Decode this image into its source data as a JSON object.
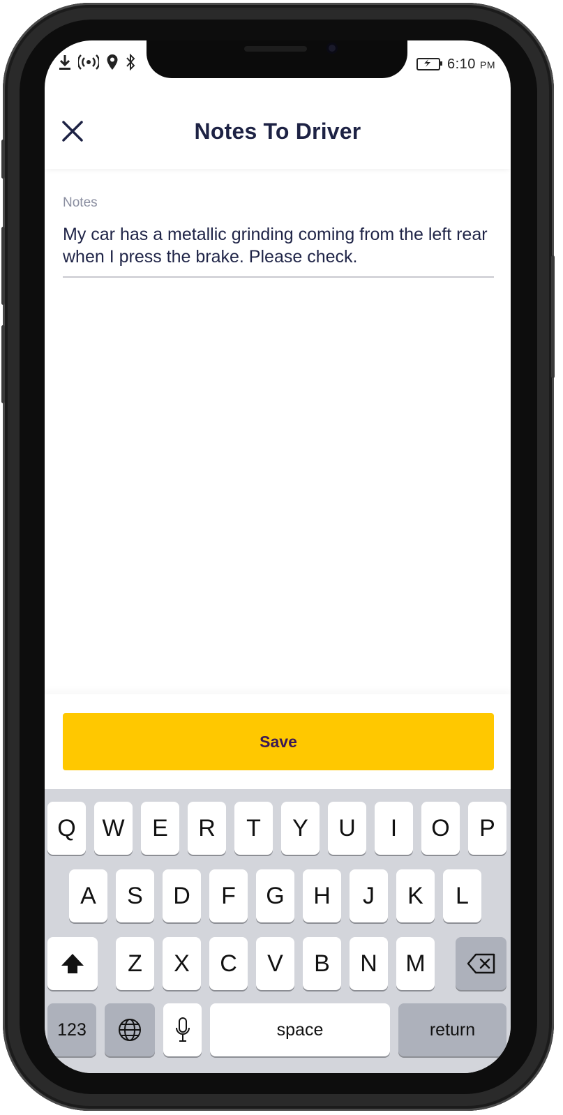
{
  "status_bar": {
    "time": "6:10",
    "ampm": "PM",
    "left_icons": [
      "download-icon",
      "hotspot-icon",
      "location-icon",
      "bluetooth-icon"
    ],
    "right_icons": [
      "battery-charging-icon"
    ]
  },
  "header": {
    "title": "Notes To Driver",
    "close_icon": "close-icon"
  },
  "notes": {
    "label": "Notes",
    "value": "My car has a metallic grinding coming from the left rear when I press the brake. Please check."
  },
  "save": {
    "label": "Save",
    "color": "#ffc800",
    "text_color": "#3a1956"
  },
  "keyboard": {
    "row1": [
      "Q",
      "W",
      "E",
      "R",
      "T",
      "Y",
      "U",
      "I",
      "O",
      "P"
    ],
    "row2": [
      "A",
      "S",
      "D",
      "F",
      "G",
      "H",
      "J",
      "K",
      "L"
    ],
    "row3": [
      "Z",
      "X",
      "C",
      "V",
      "B",
      "N",
      "M"
    ],
    "numbers_key": "123",
    "space_key": "space",
    "return_key": "return"
  },
  "colors": {
    "title": "#1d2244",
    "keyboard_bg": "#d3d5db"
  }
}
